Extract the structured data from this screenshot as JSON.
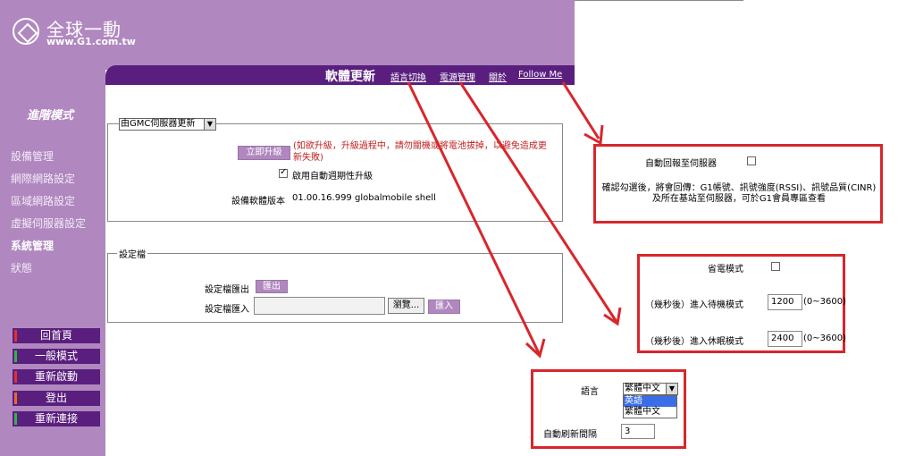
{
  "brand": {
    "name": "全球一動",
    "url": "www.G1.com.tw"
  },
  "nav": {
    "page_title": "軟體更新",
    "links": [
      "語言切換",
      "電源管理",
      "關於",
      "Follow Me"
    ]
  },
  "sidebar": {
    "mode_title": "進階模式",
    "items": [
      {
        "label": "設備管理",
        "active": false
      },
      {
        "label": "網際網路設定",
        "active": false
      },
      {
        "label": "區域網路設定",
        "active": false
      },
      {
        "label": "虛擬伺服器設定",
        "active": false
      },
      {
        "label": "系統管理",
        "active": true
      },
      {
        "label": "狀態",
        "active": false
      }
    ],
    "buttons": [
      {
        "label": "回首頁",
        "bar_color": "#e33030"
      },
      {
        "label": "一般模式",
        "bar_color": "#35b24a"
      },
      {
        "label": "重新啟動",
        "bar_color": "#e33030"
      },
      {
        "label": "登出",
        "bar_color": "#e96a2a"
      },
      {
        "label": "重新連接",
        "bar_color": "#35b24a"
      }
    ]
  },
  "update": {
    "source_select": "由GMC伺服器更新",
    "upgrade_button": "立即升級",
    "warning": "(如欲升級，升級過程中，請勿關機或將電池拔掉，以避免造成更新失敗)",
    "auto_check_label": "啟用自動週期性升級",
    "auto_check_checked": true,
    "version_label": "設備軟體版本",
    "version_value": "01.00.16.999 globalmobile shell"
  },
  "config": {
    "legend": "設定檔",
    "export_label": "設定檔匯出",
    "export_button": "匯出",
    "import_label": "設定檔匯入",
    "browse_button": "瀏覽...",
    "import_button": "匯入"
  },
  "panel_report": {
    "label": "自動回報至伺服器",
    "checked": false,
    "note": "確認勾選後，將會回傳：G1帳號、訊號強度(RSSI)、訊號品質(CINR)及所在基站至伺服器，可於G1會員專區查看"
  },
  "panel_power": {
    "power_save_label": "省電模式",
    "power_save_checked": false,
    "standby_label": "（幾秒後）進入待機模式",
    "standby_value": "1200",
    "standby_range": "(0~3600)",
    "sleep_label": "（幾秒後）進入休眠模式",
    "sleep_value": "2400",
    "sleep_range": "(0~3600)"
  },
  "panel_language": {
    "language_label": "語言",
    "language_selected": "繁體中文",
    "options": [
      "英語",
      "繁體中文"
    ],
    "refresh_label": "自動刷新間隔",
    "refresh_value": "3"
  },
  "colors": {
    "purple": "#b088bf",
    "dark_purple": "#5a1f7e",
    "annotation_red": "#d8262c"
  }
}
